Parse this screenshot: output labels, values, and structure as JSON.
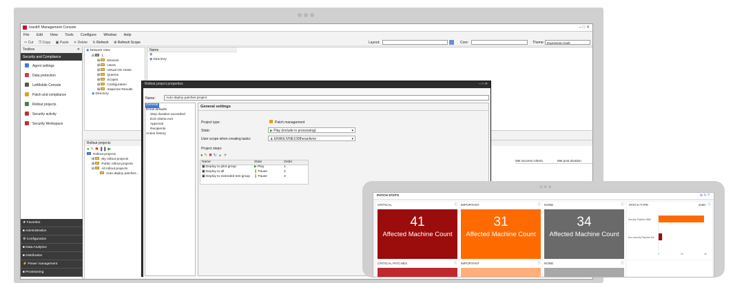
{
  "console": {
    "title": "Ivanti® Management Console",
    "menu": [
      "File",
      "Edit",
      "View",
      "Tools",
      "Configure",
      "Window",
      "Help"
    ],
    "toolbar": {
      "cut": "Cut",
      "copy": "Copy",
      "paste": "Paste",
      "delete": "Delete",
      "refresh": "Refresh",
      "refresh_scope": "Refresh Scope",
      "layout_label": "Layout:",
      "core_label": "Core:",
      "theme_label": "Theme:",
      "theme_value": "Expression Dark"
    },
    "toolbox": {
      "title": "Toolbox",
      "selected": "Security and Compliance",
      "items": [
        "Agent settings",
        "Data protection",
        "LetMobile Console",
        "Patch and compliance",
        "Rollout projects",
        "Security activity",
        "Security Workspace"
      ],
      "bottom": [
        "Favorites",
        "Administration",
        "Configuration",
        "Data Analytics",
        "Distribution",
        "Power management",
        "Provisioning"
      ]
    },
    "network_view": {
      "title": "Network View",
      "root": "1",
      "nodes": [
        "Devices",
        "Users",
        "Virtual OS Hosts",
        "Queries",
        "Scopes",
        "Configuration",
        "Inspector Results",
        "Directory"
      ]
    },
    "list_pane": {
      "header": "Name",
      "items": [
        "",
        "Directory"
      ]
    },
    "rollout": {
      "title": "Rollout projects",
      "tree": [
        "Rollout projects",
        "My rollout projects",
        "Public rollout projects",
        "All rollout projects",
        "Auto deploy patches..."
      ],
      "columns": [
        "Met success criteria",
        "Met post duration"
      ]
    },
    "dialog": {
      "title": "Rollout project properties",
      "name_label": "Name:",
      "name_value": "Auto deploy patches project",
      "nav": [
        "General",
        "Email defaults",
        "Step duration exceeded",
        "Exit criteria met",
        "Approval",
        "Recipients",
        "Action history"
      ],
      "section": "General settings",
      "project_type_label": "Project type:",
      "project_type_value": "Patch management",
      "state_label": "State:",
      "state_value": "Play (include in processing)",
      "user_scope_label": "User scope when creating tasks:",
      "user_scope_value": "ERANLIVNE1008\\eranlivne",
      "steps_label": "Project steps:",
      "steps_columns": [
        "Name",
        "State",
        "Order"
      ],
      "steps": [
        {
          "name": "Deploy to pilot group",
          "state": "Play",
          "order": "1"
        },
        {
          "name": "Deploy to all",
          "state": "Pause",
          "order": "2"
        },
        {
          "name": "Deploy to extended test group",
          "state": "Pause",
          "order": "3"
        }
      ]
    }
  },
  "dashboard": {
    "title": "PATCH STATS",
    "tiles": [
      {
        "header": "CRITICAL",
        "value": "41",
        "label": "Affected Machine Count",
        "color": "#9b0c0c"
      },
      {
        "header": "IMPORTANT",
        "value": "31",
        "label": "Affected Machine Count",
        "color": "#ff6a00"
      },
      {
        "header": "NONE",
        "value": "34",
        "label": "Affected Machine Count",
        "color": "#6a6a6a"
      }
    ],
    "row2": [
      {
        "header": "CRITICAL PATCHES",
        "color": "#c0282e"
      },
      {
        "header": "IMPORTANT",
        "color": "#ffb07a"
      },
      {
        "header": "NONE",
        "color": "#a8a8a8"
      }
    ],
    "patch_type": {
      "header": "PATCH TYPE",
      "total": "4180",
      "categories": [
        "Security Patches 3880",
        "Non-security Patches 300"
      ],
      "values": [
        3880,
        300
      ],
      "colors": [
        "#ff6a00",
        "#9b0c0c"
      ],
      "ticks": [
        "0",
        "2K",
        "4K"
      ],
      "xmax": 4000
    }
  },
  "chart_data": {
    "type": "bar",
    "title": "PATCH TYPE",
    "categories": [
      "Security Patches 3880",
      "Non-security Patches 300"
    ],
    "values": [
      3880,
      300
    ],
    "xlim": [
      0,
      4000
    ]
  }
}
